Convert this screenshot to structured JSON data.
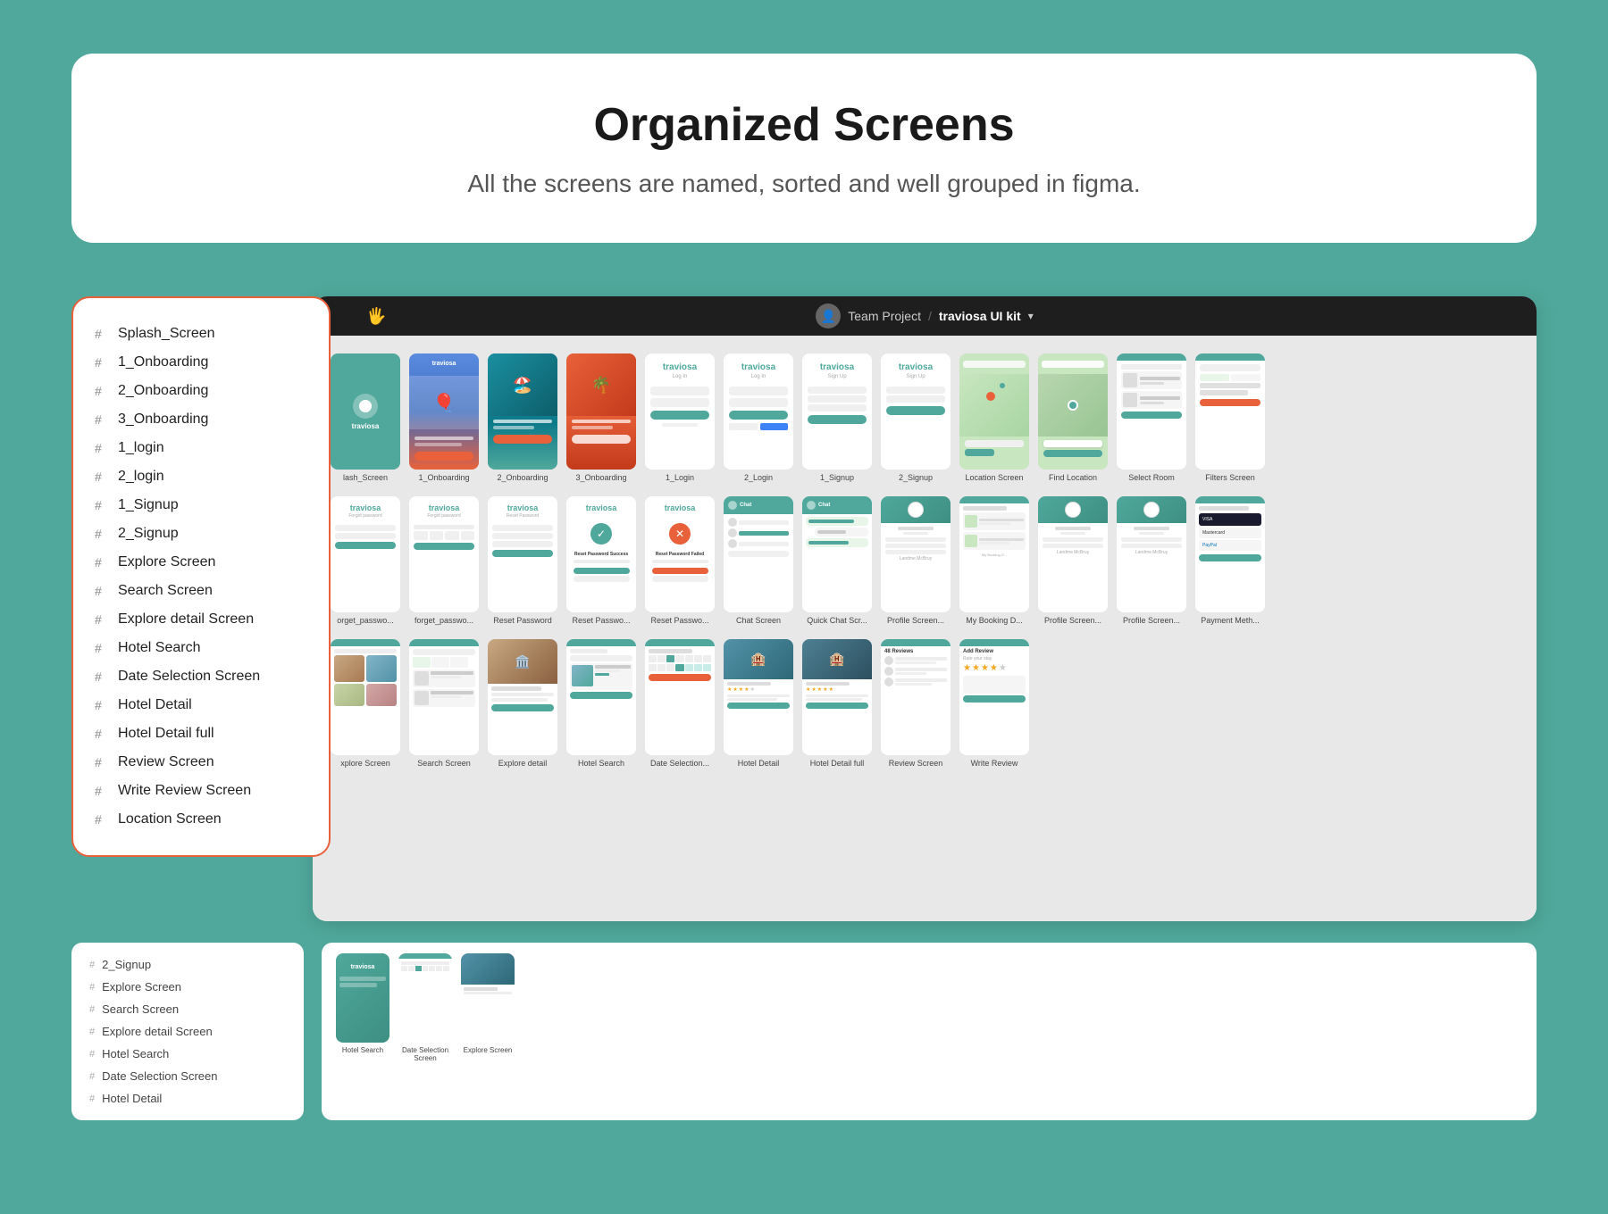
{
  "header": {
    "title": "Organized Screens",
    "subtitle": "All the screens are named, sorted and well grouped in figma."
  },
  "figma_topbar": {
    "icon_label": "hand-icon",
    "avatar_label": "user-avatar",
    "breadcrumb": "Team Project / traviosa UI kit ▾"
  },
  "sidebar": {
    "items": [
      {
        "id": "splash-screen",
        "label": "Splash_Screen"
      },
      {
        "id": "1-onboarding",
        "label": "1_Onboarding"
      },
      {
        "id": "2-onboarding",
        "label": "2_Onboarding"
      },
      {
        "id": "3-onboarding",
        "label": "3_Onboarding"
      },
      {
        "id": "1-login",
        "label": "1_login"
      },
      {
        "id": "2-login",
        "label": "2_login"
      },
      {
        "id": "1-signup",
        "label": "1_Signup"
      },
      {
        "id": "2-signup",
        "label": "2_Signup"
      },
      {
        "id": "explore-screen",
        "label": "Explore Screen"
      },
      {
        "id": "search-screen",
        "label": "Search Screen"
      },
      {
        "id": "explore-detail-screen",
        "label": "Explore detail Screen"
      },
      {
        "id": "hotel-search",
        "label": "Hotel Search"
      },
      {
        "id": "date-selection-screen",
        "label": "Date Selection Screen"
      },
      {
        "id": "hotel-detail",
        "label": "Hotel Detail"
      },
      {
        "id": "hotel-detail-full",
        "label": "Hotel Detail full"
      },
      {
        "id": "review-screen",
        "label": "Review Screen"
      },
      {
        "id": "write-review-screen",
        "label": "Write Review Screen"
      },
      {
        "id": "location-screen",
        "label": "Location Screen"
      }
    ]
  },
  "canvas_rows": [
    {
      "row": 1,
      "screens": [
        {
          "label": "lash_Screen",
          "type": "splash"
        },
        {
          "label": "1_Onboarding",
          "type": "onboarding1"
        },
        {
          "label": "2_Onboarding",
          "type": "onboarding2"
        },
        {
          "label": "3_Onboarding",
          "type": "onboarding3"
        },
        {
          "label": "1_Login",
          "type": "login1"
        },
        {
          "label": "2_Login",
          "type": "login2"
        },
        {
          "label": "1_Signup",
          "type": "signup1"
        },
        {
          "label": "2_Signup",
          "type": "signup2"
        },
        {
          "label": "Location Screen",
          "type": "location"
        },
        {
          "label": "Find Location",
          "type": "findlocation"
        },
        {
          "label": "Select Room",
          "type": "selectroom"
        },
        {
          "label": "Filters Screen",
          "type": "filters"
        }
      ]
    },
    {
      "row": 2,
      "screens": [
        {
          "label": "orget_passwo...",
          "type": "forgot1"
        },
        {
          "label": "forget_passwo...",
          "type": "forgot2"
        },
        {
          "label": "Reset Password",
          "type": "reset1"
        },
        {
          "label": "Reset Passwo...",
          "type": "reset2"
        },
        {
          "label": "Reset Passwo...",
          "type": "reset3"
        },
        {
          "label": "Chat Screen",
          "type": "chat"
        },
        {
          "label": "Quick Chat Scr...",
          "type": "quickchat"
        },
        {
          "label": "Profile Screen...",
          "type": "profile1"
        },
        {
          "label": "My Booking D...",
          "type": "booking"
        },
        {
          "label": "Profile Screen...",
          "type": "profile2"
        },
        {
          "label": "Profile Screen...",
          "type": "profile3"
        },
        {
          "label": "Payment Meth...",
          "type": "payment"
        }
      ]
    },
    {
      "row": 3,
      "screens": [
        {
          "label": "xplore Screen",
          "type": "explore"
        },
        {
          "label": "Search Screen",
          "type": "search"
        },
        {
          "label": "Explore detail",
          "type": "exploredetail"
        },
        {
          "label": "Hotel Search",
          "type": "hotelsearch"
        },
        {
          "label": "Date Selection...",
          "type": "dateselection"
        },
        {
          "label": "Hotel Detail",
          "type": "hoteldetail"
        },
        {
          "label": "Hotel Detail full",
          "type": "hoteldetailfull"
        },
        {
          "label": "Review Screen",
          "type": "reviewscreen"
        },
        {
          "label": "Write Review",
          "type": "writereview"
        }
      ]
    }
  ],
  "bottom_section": {
    "items": [
      {
        "label": "2_Signup"
      },
      {
        "label": "Explore Screen"
      },
      {
        "label": "Search Screen"
      },
      {
        "label": "Explore detail Screen"
      },
      {
        "label": "Hotel Search"
      },
      {
        "label": "Date Selection Screen"
      },
      {
        "label": "Hotel Detail"
      }
    ]
  }
}
